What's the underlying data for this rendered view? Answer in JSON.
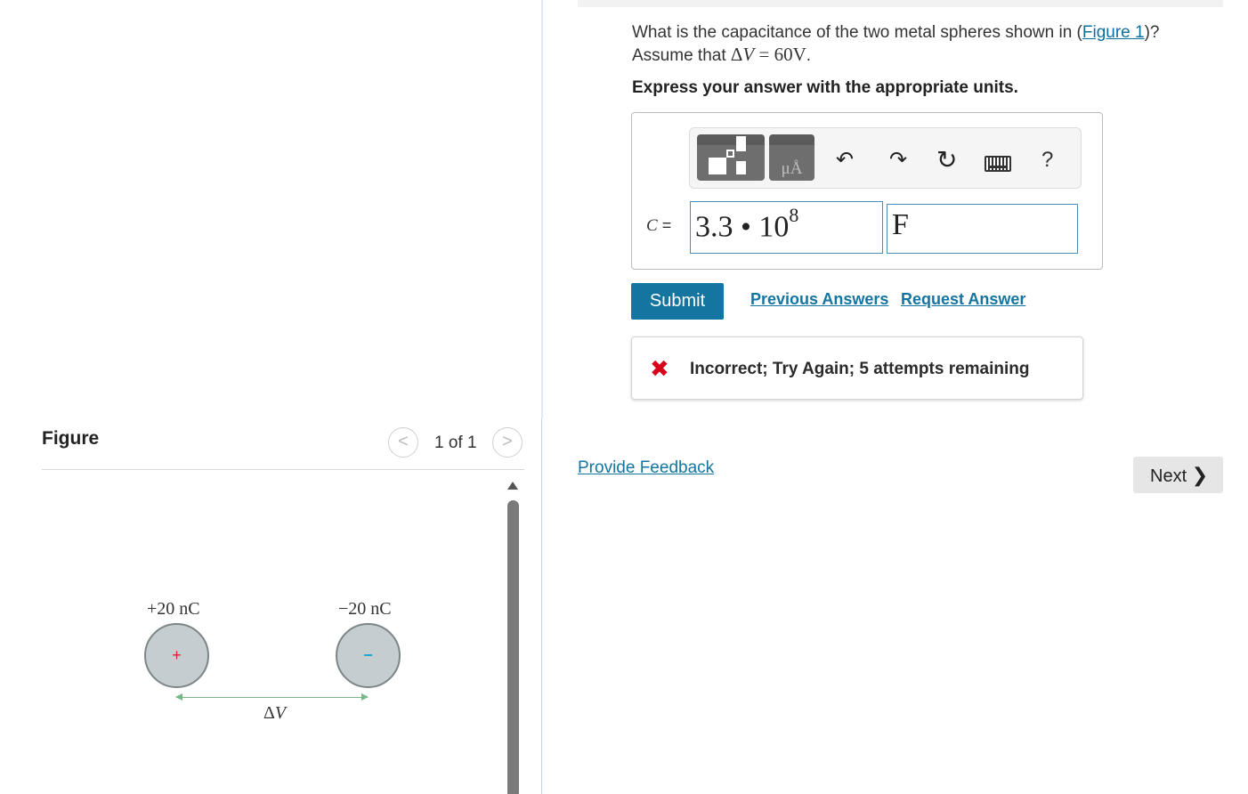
{
  "question": {
    "text_before": "What is the capacitance of the two metal spheres shown in (",
    "figure_link": "Figure 1",
    "text_after": ")?",
    "assume_prefix": "Assume that ",
    "assume_delta": "Δ",
    "assume_var": "V",
    "assume_value": " = 60V",
    "assume_suffix": "."
  },
  "instruction": "Express your answer with the appropriate units.",
  "toolbar": {
    "template_icon": "templates-icon",
    "units_glyph": "μÅ",
    "undo_glyph": "↶",
    "redo_glyph": "↷",
    "reset_glyph": "↻",
    "keyboard_icon": "keyboard-icon",
    "help_glyph": "?"
  },
  "answer": {
    "variable": "C",
    "equals": " =",
    "value_base": "3.3 • 10",
    "value_exp": "8",
    "unit": "F"
  },
  "actions": {
    "submit": "Submit",
    "previous_answers": "Previous Answers",
    "request_answer": "Request Answer"
  },
  "feedback": {
    "icon": "✖",
    "text": "Incorrect; Try Again; 5 attempts remaining"
  },
  "footer": {
    "provide_feedback": "Provide Feedback",
    "next": "Next",
    "next_chevron": "❯"
  },
  "figure": {
    "title": "Figure",
    "prev": "<",
    "next": ">",
    "pager": "1 of 1",
    "left_charge": "+20 nC",
    "right_charge": "−20 nC",
    "left_sign": "+",
    "right_sign": "−",
    "dv_delta": "Δ",
    "dv_var": "V"
  },
  "colors": {
    "accent": "#1475a0",
    "error": "#d9001b",
    "sphere": "#c4cdcf"
  }
}
